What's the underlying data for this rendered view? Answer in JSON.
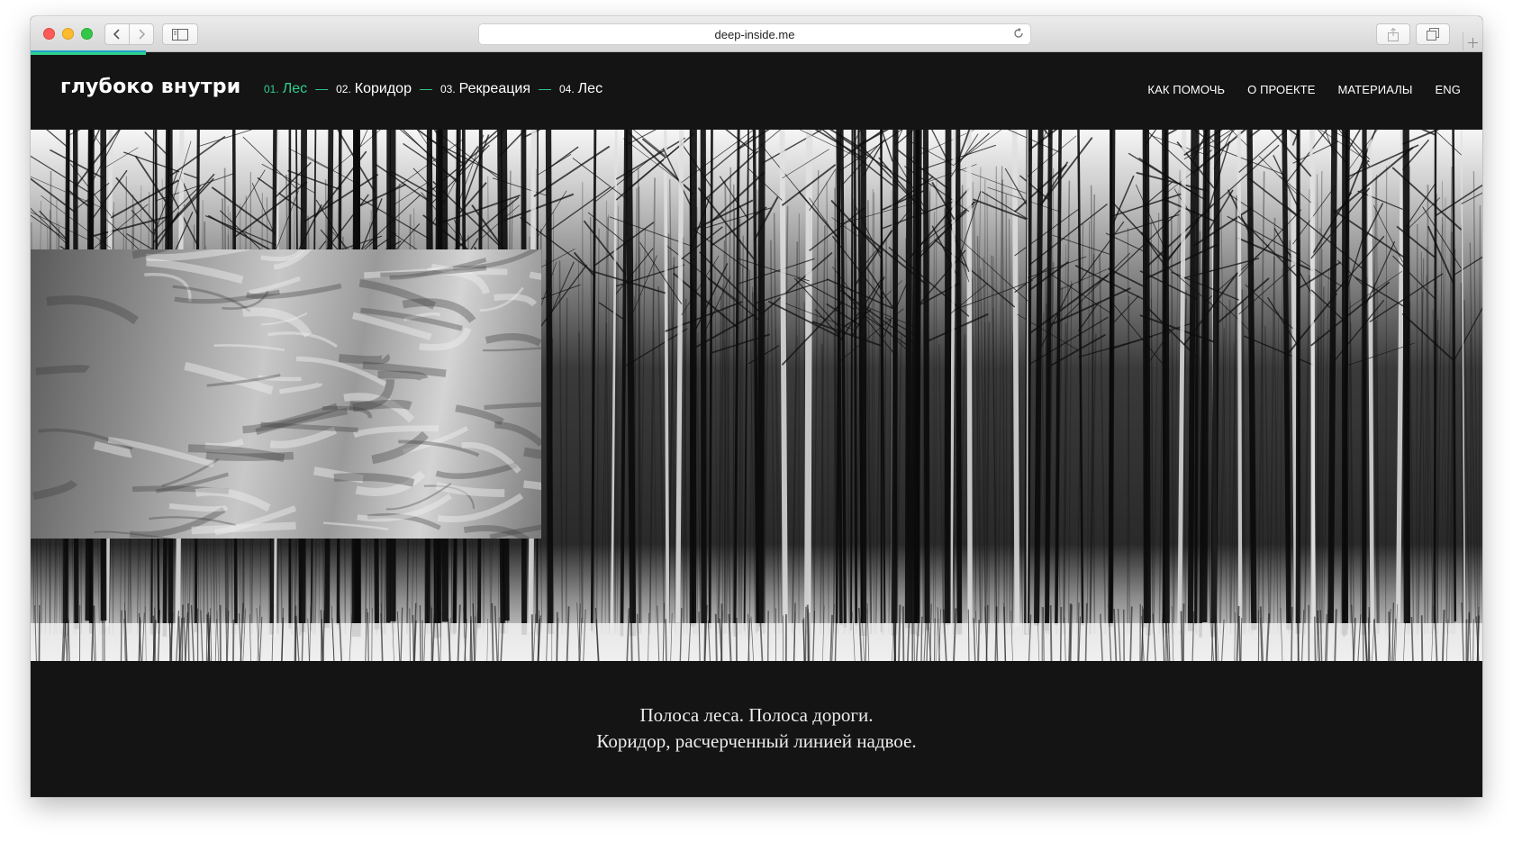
{
  "browser": {
    "url": "deep-inside.me",
    "buttons": [
      "back-icon",
      "forward-icon",
      "sidebar-icon",
      "share-icon",
      "tabs-icon",
      "plus-icon"
    ]
  },
  "site": {
    "logo": "глубоко внутри",
    "chapters": [
      {
        "num": "01.",
        "label": "Лес",
        "active": true
      },
      {
        "num": "02.",
        "label": "Коридор",
        "active": false
      },
      {
        "num": "03.",
        "label": "Рекреация",
        "active": false
      },
      {
        "num": "04.",
        "label": "Лес",
        "active": false
      }
    ],
    "separator": "—",
    "menu": [
      "КАК ПОМОЧЬ",
      "О ПРОЕКТЕ",
      "МАТЕРИАЛЫ",
      "ENG"
    ]
  },
  "caption": {
    "line1": "Полоса леса. Полоса дороги.",
    "line2": "Коридор, расчерченный линией надвое."
  },
  "colors": {
    "accent": "#2fcf8e",
    "background": "#141414",
    "text": "#ffffff"
  }
}
